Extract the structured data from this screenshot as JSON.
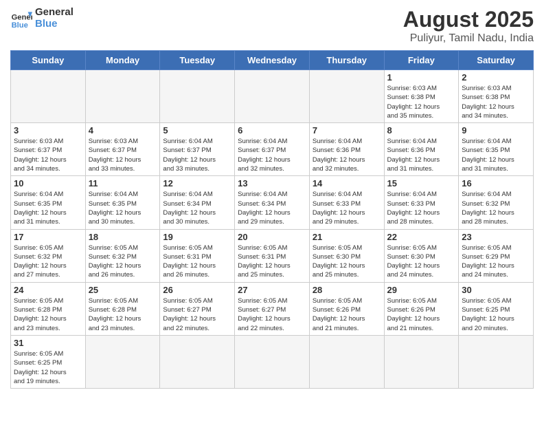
{
  "header": {
    "logo_general": "General",
    "logo_blue": "Blue",
    "title": "August 2025",
    "subtitle": "Puliyur, Tamil Nadu, India"
  },
  "days_of_week": [
    "Sunday",
    "Monday",
    "Tuesday",
    "Wednesday",
    "Thursday",
    "Friday",
    "Saturday"
  ],
  "weeks": [
    [
      {
        "day": "",
        "detail": ""
      },
      {
        "day": "",
        "detail": ""
      },
      {
        "day": "",
        "detail": ""
      },
      {
        "day": "",
        "detail": ""
      },
      {
        "day": "",
        "detail": ""
      },
      {
        "day": "1",
        "detail": "Sunrise: 6:03 AM\nSunset: 6:38 PM\nDaylight: 12 hours\nand 35 minutes."
      },
      {
        "day": "2",
        "detail": "Sunrise: 6:03 AM\nSunset: 6:38 PM\nDaylight: 12 hours\nand 34 minutes."
      }
    ],
    [
      {
        "day": "3",
        "detail": "Sunrise: 6:03 AM\nSunset: 6:37 PM\nDaylight: 12 hours\nand 34 minutes."
      },
      {
        "day": "4",
        "detail": "Sunrise: 6:03 AM\nSunset: 6:37 PM\nDaylight: 12 hours\nand 33 minutes."
      },
      {
        "day": "5",
        "detail": "Sunrise: 6:04 AM\nSunset: 6:37 PM\nDaylight: 12 hours\nand 33 minutes."
      },
      {
        "day": "6",
        "detail": "Sunrise: 6:04 AM\nSunset: 6:37 PM\nDaylight: 12 hours\nand 32 minutes."
      },
      {
        "day": "7",
        "detail": "Sunrise: 6:04 AM\nSunset: 6:36 PM\nDaylight: 12 hours\nand 32 minutes."
      },
      {
        "day": "8",
        "detail": "Sunrise: 6:04 AM\nSunset: 6:36 PM\nDaylight: 12 hours\nand 31 minutes."
      },
      {
        "day": "9",
        "detail": "Sunrise: 6:04 AM\nSunset: 6:35 PM\nDaylight: 12 hours\nand 31 minutes."
      }
    ],
    [
      {
        "day": "10",
        "detail": "Sunrise: 6:04 AM\nSunset: 6:35 PM\nDaylight: 12 hours\nand 31 minutes."
      },
      {
        "day": "11",
        "detail": "Sunrise: 6:04 AM\nSunset: 6:35 PM\nDaylight: 12 hours\nand 30 minutes."
      },
      {
        "day": "12",
        "detail": "Sunrise: 6:04 AM\nSunset: 6:34 PM\nDaylight: 12 hours\nand 30 minutes."
      },
      {
        "day": "13",
        "detail": "Sunrise: 6:04 AM\nSunset: 6:34 PM\nDaylight: 12 hours\nand 29 minutes."
      },
      {
        "day": "14",
        "detail": "Sunrise: 6:04 AM\nSunset: 6:33 PM\nDaylight: 12 hours\nand 29 minutes."
      },
      {
        "day": "15",
        "detail": "Sunrise: 6:04 AM\nSunset: 6:33 PM\nDaylight: 12 hours\nand 28 minutes."
      },
      {
        "day": "16",
        "detail": "Sunrise: 6:04 AM\nSunset: 6:32 PM\nDaylight: 12 hours\nand 28 minutes."
      }
    ],
    [
      {
        "day": "17",
        "detail": "Sunrise: 6:05 AM\nSunset: 6:32 PM\nDaylight: 12 hours\nand 27 minutes."
      },
      {
        "day": "18",
        "detail": "Sunrise: 6:05 AM\nSunset: 6:32 PM\nDaylight: 12 hours\nand 26 minutes."
      },
      {
        "day": "19",
        "detail": "Sunrise: 6:05 AM\nSunset: 6:31 PM\nDaylight: 12 hours\nand 26 minutes."
      },
      {
        "day": "20",
        "detail": "Sunrise: 6:05 AM\nSunset: 6:31 PM\nDaylight: 12 hours\nand 25 minutes."
      },
      {
        "day": "21",
        "detail": "Sunrise: 6:05 AM\nSunset: 6:30 PM\nDaylight: 12 hours\nand 25 minutes."
      },
      {
        "day": "22",
        "detail": "Sunrise: 6:05 AM\nSunset: 6:30 PM\nDaylight: 12 hours\nand 24 minutes."
      },
      {
        "day": "23",
        "detail": "Sunrise: 6:05 AM\nSunset: 6:29 PM\nDaylight: 12 hours\nand 24 minutes."
      }
    ],
    [
      {
        "day": "24",
        "detail": "Sunrise: 6:05 AM\nSunset: 6:28 PM\nDaylight: 12 hours\nand 23 minutes."
      },
      {
        "day": "25",
        "detail": "Sunrise: 6:05 AM\nSunset: 6:28 PM\nDaylight: 12 hours\nand 23 minutes."
      },
      {
        "day": "26",
        "detail": "Sunrise: 6:05 AM\nSunset: 6:27 PM\nDaylight: 12 hours\nand 22 minutes."
      },
      {
        "day": "27",
        "detail": "Sunrise: 6:05 AM\nSunset: 6:27 PM\nDaylight: 12 hours\nand 22 minutes."
      },
      {
        "day": "28",
        "detail": "Sunrise: 6:05 AM\nSunset: 6:26 PM\nDaylight: 12 hours\nand 21 minutes."
      },
      {
        "day": "29",
        "detail": "Sunrise: 6:05 AM\nSunset: 6:26 PM\nDaylight: 12 hours\nand 21 minutes."
      },
      {
        "day": "30",
        "detail": "Sunrise: 6:05 AM\nSunset: 6:25 PM\nDaylight: 12 hours\nand 20 minutes."
      }
    ],
    [
      {
        "day": "31",
        "detail": "Sunrise: 6:05 AM\nSunset: 6:25 PM\nDaylight: 12 hours\nand 19 minutes."
      },
      {
        "day": "",
        "detail": ""
      },
      {
        "day": "",
        "detail": ""
      },
      {
        "day": "",
        "detail": ""
      },
      {
        "day": "",
        "detail": ""
      },
      {
        "day": "",
        "detail": ""
      },
      {
        "day": "",
        "detail": ""
      }
    ]
  ]
}
